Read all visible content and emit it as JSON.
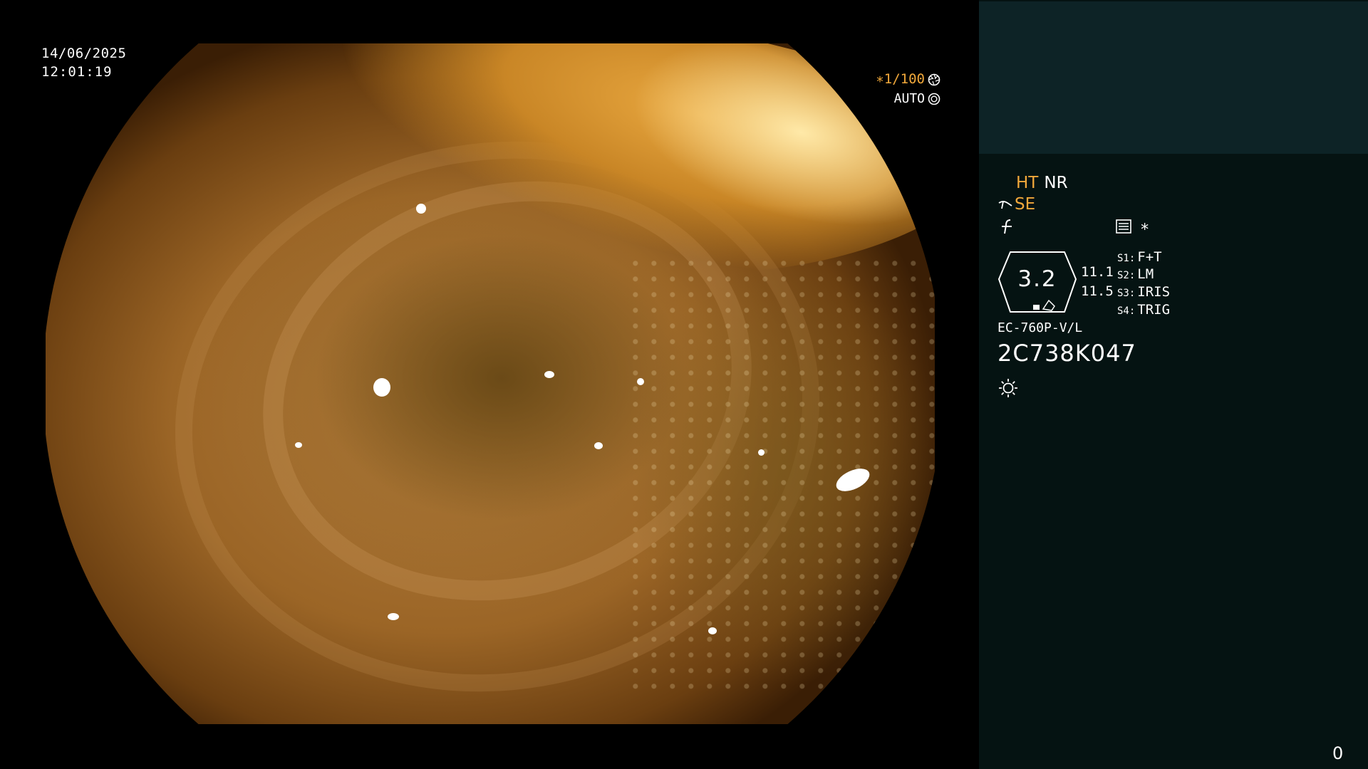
{
  "overlay": {
    "date": "14/06/2025",
    "time": "12:01:19",
    "shutter": "∗1/100",
    "shutter_icon": "aperture-icon",
    "exposure": "AUTO",
    "exposure_icon": "iris-icon"
  },
  "panel": {
    "mode_ht": "HT",
    "mode_nr": "NR",
    "mode_se": "SE",
    "se_icon": "probe-icon",
    "f_icon": "enhancement-icon",
    "menu_icon": "menu-list-icon",
    "star": "∗",
    "zoom_value": "3.2",
    "value_a": "11.1",
    "value_b": "11.5",
    "switches": [
      {
        "key": "S1:",
        "value": "F+T"
      },
      {
        "key": "S2:",
        "value": "LM"
      },
      {
        "key": "S3:",
        "value": "IRIS"
      },
      {
        "key": "S4:",
        "value": "TRIG"
      }
    ],
    "scope_model": "EC-760P-V/L",
    "serial": "2C738K047",
    "light_icon": "sun-icon",
    "counter": "0"
  },
  "colors": {
    "accent_orange": "#f2a93b",
    "panel_bg": "#051312",
    "panel_top_bg": "#0d2326",
    "text": "#ffffff"
  }
}
